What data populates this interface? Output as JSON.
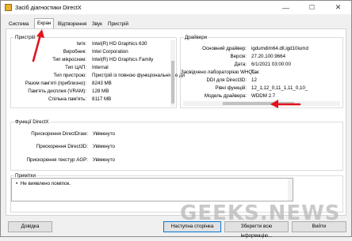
{
  "window": {
    "title": "Засіб діагностики DirectX",
    "minimize": "—",
    "maximize": "☐",
    "close": "✕"
  },
  "tabs": [
    {
      "label": "Система"
    },
    {
      "label": "Екран"
    },
    {
      "label": "Відтворення"
    },
    {
      "label": "Звук"
    },
    {
      "label": "Пристрій вводу"
    }
  ],
  "device": {
    "title": "Пристрій",
    "rows": [
      {
        "label": "Ім'я:",
        "value": "Intel(R) HD Graphics 630"
      },
      {
        "label": "Виробник:",
        "value": "Intel Corporation"
      },
      {
        "label": "Тип мікросхем:",
        "value": "Intel(R) HD Graphics Family"
      },
      {
        "label": "Тип ЦАП:",
        "value": "Internal"
      },
      {
        "label": "Тип пристрою:",
        "value": "Пристрій із повною функціональністю ди"
      },
      {
        "label": "Разом пам'яті (приблизно):",
        "value": "8243 MB"
      },
      {
        "label": "Пам'ять дисплея (VRAM):",
        "value": "128 MB"
      },
      {
        "label": "Спільна пам'ять:",
        "value": "8117 MB"
      }
    ]
  },
  "drivers": {
    "title": "Драйвери",
    "rows": [
      {
        "label": "Основний драйвер:",
        "value": "igdumdim64.dll,igd10iumd"
      },
      {
        "label": "Версія:",
        "value": "27.20.100.9664"
      },
      {
        "label": "Дата:",
        "value": "6/1/2021 03:00:00"
      },
      {
        "label": "Засвідчено лабораторією WHQL:",
        "value": "Так"
      },
      {
        "label": "DDI для Direct3D:",
        "value": "12"
      },
      {
        "label": "Рівні функцій:",
        "value": "12_1,12_0,11_1,11_0,10_"
      },
      {
        "label": "Модель драйвера:",
        "value": "WDDM 2.7"
      }
    ]
  },
  "features": {
    "title": "Функції DirectX",
    "rows": [
      {
        "label": "Прискорення DirectDraw:",
        "value": "Увімкнуто"
      },
      {
        "label": "Прискорення Direct3D:",
        "value": "Увімкнуто"
      },
      {
        "label": "Прискорення текстур AGP:",
        "value": "Увімкнуто"
      }
    ]
  },
  "notes": {
    "title": "Примітки",
    "items": [
      "Не виявлено поміпок."
    ]
  },
  "buttons": {
    "help": "Довідка",
    "next": "Наступна сторінка",
    "save": "Зберегти всю інформацію...",
    "exit": "Вийти"
  },
  "watermark": "GEEKS.NEWS",
  "colors": {
    "annotation_arrow": "#e0141e",
    "focus_border": "#0078d7"
  }
}
